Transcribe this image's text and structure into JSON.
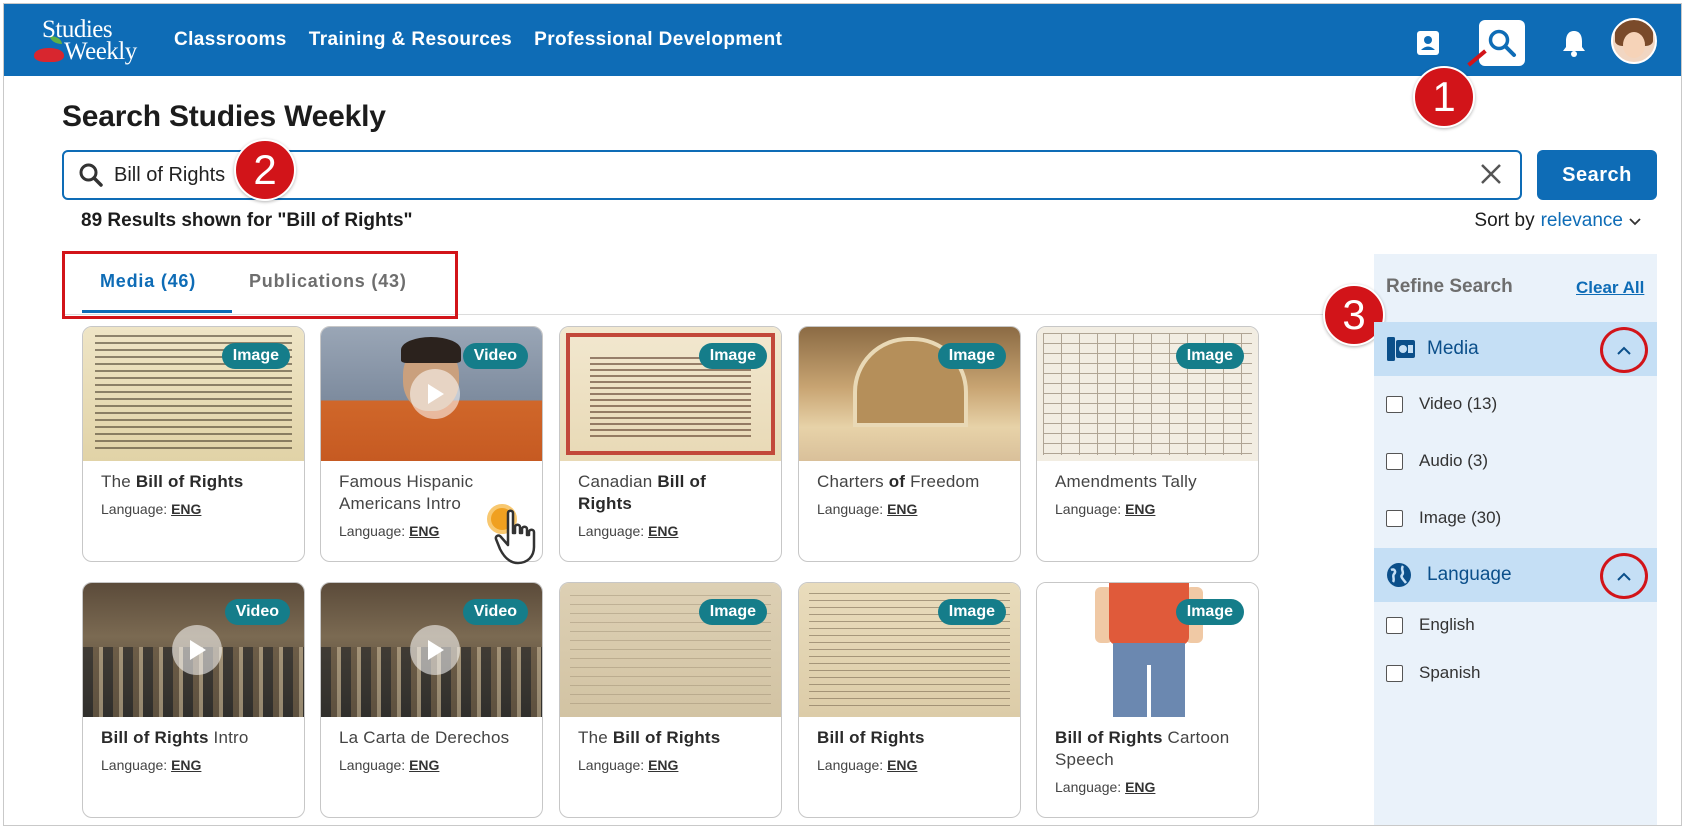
{
  "nav": {
    "logo_line1": "Studies",
    "logo_line2": "Weekly",
    "links": [
      "Classrooms",
      "Training & Resources",
      "Professional Development"
    ]
  },
  "page": {
    "title": "Search Studies Weekly",
    "search_value": "Bill of Rights",
    "search_button": "Search",
    "results_count": "89 Results shown for \"Bill of Rights\"",
    "sort_label": "Sort by",
    "sort_value": "relevance"
  },
  "tabs": [
    {
      "label": "Media (46)",
      "active": true
    },
    {
      "label": "Publications (43)",
      "active": false
    }
  ],
  "annotations": [
    "1",
    "2",
    "3"
  ],
  "cards": [
    {
      "tag": "Image",
      "title_pre": "The ",
      "title_bold": "Bill of Rights",
      "title_post": "",
      "lang_label": "Language:",
      "lang": "ENG"
    },
    {
      "tag": "Video",
      "title_pre": "Famous Hispanic Americans Intro",
      "title_bold": "",
      "title_post": "",
      "lang_label": "Language:",
      "lang": "ENG"
    },
    {
      "tag": "Image",
      "title_pre": "Canadian ",
      "title_bold": "Bill of Rights",
      "title_post": "",
      "lang_label": "Language:",
      "lang": "ENG"
    },
    {
      "tag": "Image",
      "title_pre": "Charters ",
      "title_bold": "of",
      "title_post": " Freedom",
      "lang_label": "Language:",
      "lang": "ENG"
    },
    {
      "tag": "Image",
      "title_pre": "Amendments Tally",
      "title_bold": "",
      "title_post": "",
      "lang_label": "Language:",
      "lang": "ENG"
    },
    {
      "tag": "Video",
      "title_pre": "",
      "title_bold": "Bill of Rights",
      "title_post": " Intro",
      "lang_label": "Language:",
      "lang": "ENG"
    },
    {
      "tag": "Video",
      "title_pre": "La Carta de Derechos",
      "title_bold": "",
      "title_post": "",
      "lang_label": "Language:",
      "lang": "ENG"
    },
    {
      "tag": "Image",
      "title_pre": "The ",
      "title_bold": "Bill of Rights",
      "title_post": "",
      "lang_label": "Language:",
      "lang": "ENG"
    },
    {
      "tag": "Image",
      "title_pre": "",
      "title_bold": "Bill of Rights",
      "title_post": "",
      "lang_label": "Language:",
      "lang": "ENG"
    },
    {
      "tag": "Image",
      "title_pre": "",
      "title_bold": "Bill of Rights",
      "title_post": " Cartoon Speech",
      "lang_label": "Language:",
      "lang": "ENG"
    }
  ],
  "refine": {
    "title": "Refine Search",
    "clear_all": "Clear All",
    "media": {
      "label": "Media",
      "options": [
        "Video (13)",
        "Audio (3)",
        "Image (30)"
      ]
    },
    "language": {
      "label": "Language",
      "options": [
        "English",
        "Spanish"
      ]
    }
  },
  "colors": {
    "brand_blue": "#0e6cb6",
    "tag_teal": "#157d8a",
    "annotation_red": "#d21419"
  }
}
